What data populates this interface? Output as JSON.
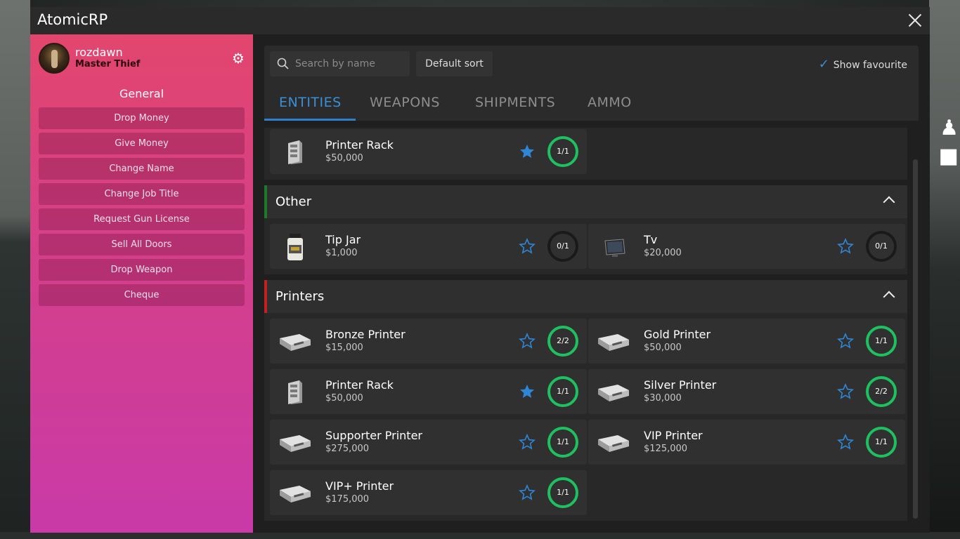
{
  "window": {
    "title": "AtomicRP"
  },
  "profile": {
    "username": "rozdawn",
    "job": "Master Thief"
  },
  "sidebar": {
    "heading": "General",
    "buttons": [
      "Drop Money",
      "Give Money",
      "Change Name",
      "Change Job Title",
      "Request Gun License",
      "Sell All Doors",
      "Drop Weapon",
      "Cheque"
    ]
  },
  "toolbar": {
    "search_placeholder": "Search by name",
    "sort_label": "Default sort",
    "favourite_label": "Show favourite",
    "favourite_checked": true
  },
  "tabs": [
    "ENTITIES",
    "WEAPONS",
    "SHIPMENTS",
    "AMMO"
  ],
  "active_tab": "ENTITIES",
  "colors": {
    "accent": "#3b8fd6",
    "ring_full": "#1fc060",
    "other_bar": "#1e7a2a",
    "printers_bar": "#c42020"
  },
  "top_items": [
    {
      "name": "Printer Rack",
      "price": "$50,000",
      "count": "1/1",
      "favourite": true,
      "icon": "rack-icon"
    }
  ],
  "categories": [
    {
      "title": "Other",
      "items": [
        {
          "name": "Tip Jar",
          "price": "$1,000",
          "count": "0/1",
          "favourite": false,
          "icon": "jar-icon"
        },
        {
          "name": "Tv",
          "price": "$20,000",
          "count": "0/1",
          "favourite": false,
          "icon": "tv-icon"
        }
      ]
    },
    {
      "title": "Printers",
      "items": [
        {
          "name": "Bronze Printer",
          "price": "$15,000",
          "count": "2/2",
          "favourite": false,
          "icon": "printer-icon"
        },
        {
          "name": "Gold Printer",
          "price": "$50,000",
          "count": "1/1",
          "favourite": false,
          "icon": "printer-icon"
        },
        {
          "name": "Printer Rack",
          "price": "$50,000",
          "count": "1/1",
          "favourite": true,
          "icon": "rack-icon"
        },
        {
          "name": "Silver Printer",
          "price": "$30,000",
          "count": "2/2",
          "favourite": false,
          "icon": "printer-icon"
        },
        {
          "name": "Supporter Printer",
          "price": "$275,000",
          "count": "1/1",
          "favourite": false,
          "icon": "printer-icon"
        },
        {
          "name": "VIP Printer",
          "price": "$125,000",
          "count": "1/1",
          "favourite": false,
          "icon": "printer-icon"
        },
        {
          "name": "VIP+ Printer",
          "price": "$175,000",
          "count": "1/1",
          "favourite": false,
          "icon": "printer-icon"
        }
      ]
    }
  ]
}
